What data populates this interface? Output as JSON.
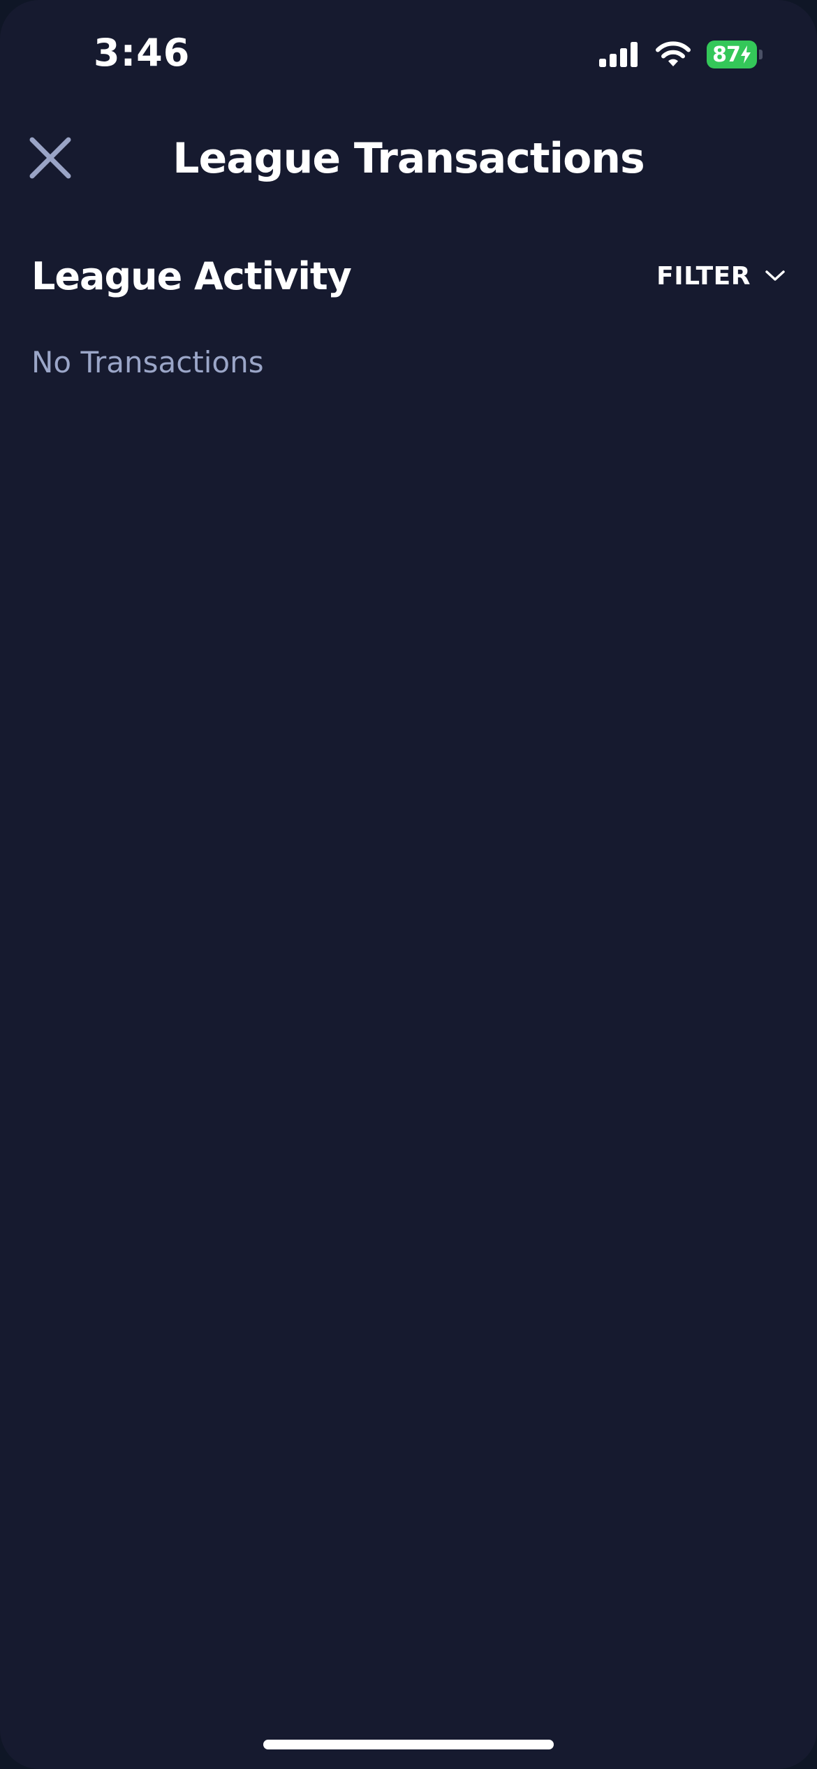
{
  "status_bar": {
    "time": "3:46",
    "battery_level": "87",
    "battery_charging": true,
    "battery_color": "#34c759",
    "icons": [
      "signal-icon",
      "wifi-icon",
      "battery-icon"
    ]
  },
  "header": {
    "title": "League Transactions",
    "close_icon": "close-icon"
  },
  "section": {
    "title": "League Activity",
    "filter_label": "FILTER",
    "filter_icon": "chevron-down-icon"
  },
  "content": {
    "empty_message": "No Transactions"
  },
  "colors": {
    "background": "#161a2f",
    "primary_text": "#ffffff",
    "muted_text": "#9ba6c8",
    "close_icon": "#9aa4c6"
  }
}
